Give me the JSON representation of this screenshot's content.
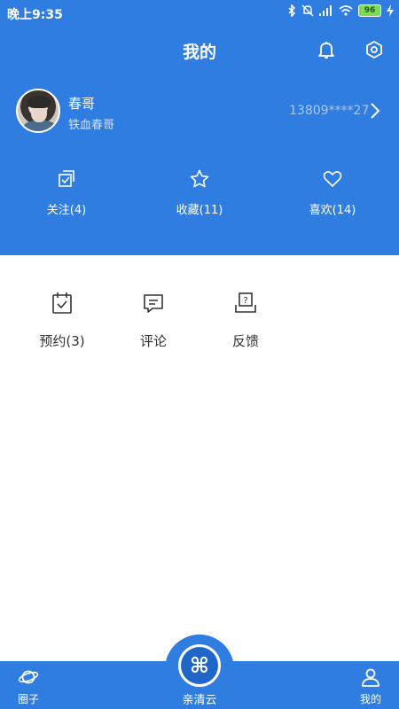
{
  "status_bar": {
    "time": "晚上9:35",
    "battery": "96",
    "icons": [
      "bluetooth-icon",
      "mute-icon",
      "signal-icon",
      "wifi-icon",
      "battery-icon",
      "charging-icon"
    ]
  },
  "header": {
    "title": "我的",
    "background_color": "#2f7de1"
  },
  "profile": {
    "name": "春哥",
    "subtitle": "铁血春哥",
    "phone": "13809****27"
  },
  "stats": [
    {
      "label": "关注(4)",
      "icon": "follow-icon"
    },
    {
      "label": "收藏(11)",
      "icon": "star-icon"
    },
    {
      "label": "喜欢(14)",
      "icon": "heart-icon"
    }
  ],
  "tools": [
    {
      "label": "预约(3)",
      "icon": "calendar-icon"
    },
    {
      "label": "评论",
      "icon": "comment-icon"
    },
    {
      "label": "反馈",
      "icon": "feedback-icon"
    }
  ],
  "tabbar": {
    "tabs": [
      {
        "label": "圈子",
        "icon": "planet-icon"
      },
      {
        "label": "亲清云",
        "icon": "command-icon"
      },
      {
        "label": "我的",
        "icon": "person-icon"
      }
    ],
    "center_glyph": "⌘"
  }
}
